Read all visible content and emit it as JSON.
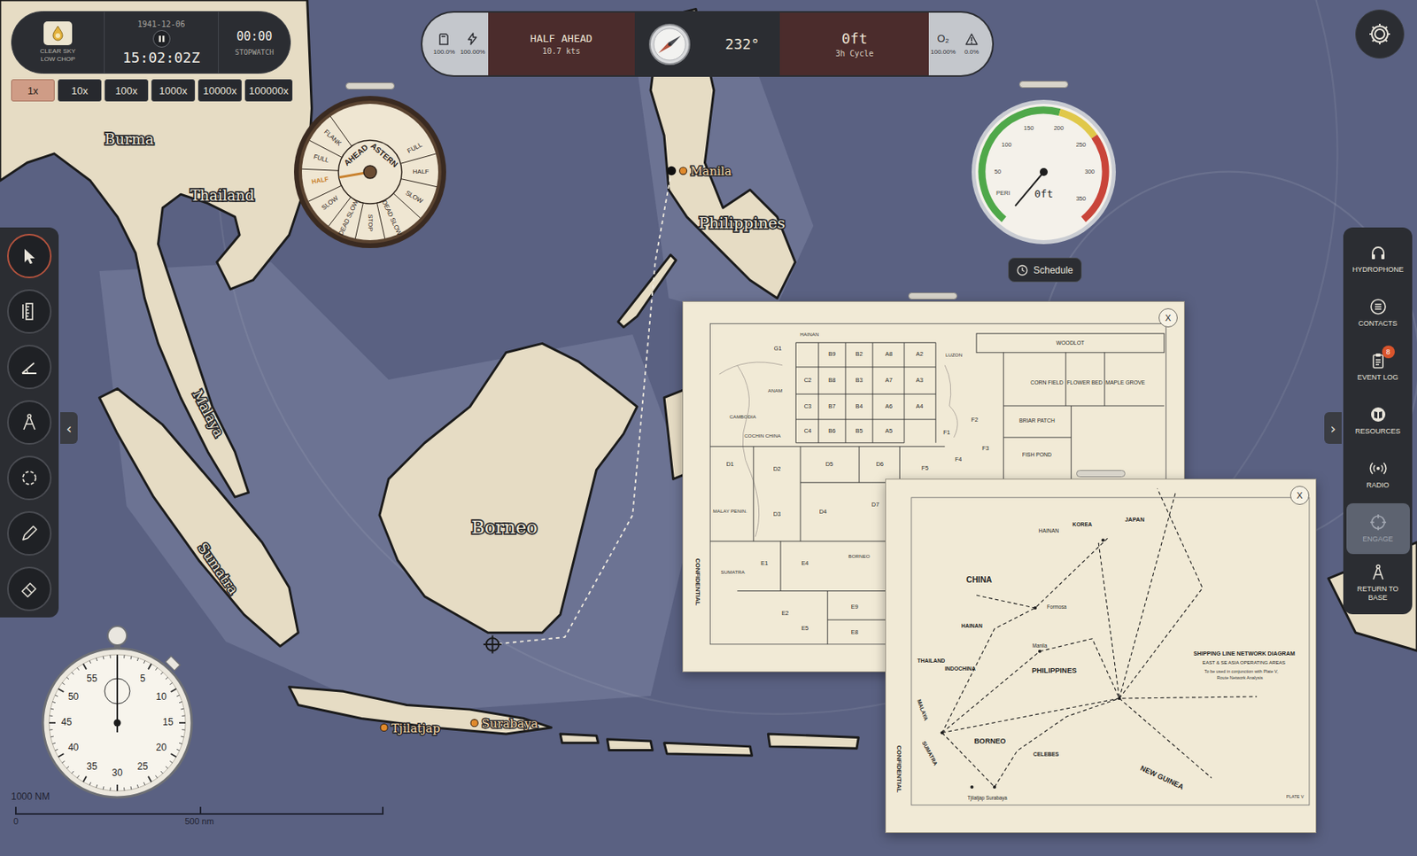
{
  "clock": {
    "weather": {
      "sky": "CLEAR SKY",
      "sea": "LOW CHOP"
    },
    "date": "1941-12-06",
    "time": "15:02:02Z",
    "running": true,
    "stopwatch": "00:00",
    "stopwatch_label": "STOPWATCH"
  },
  "time_compression": [
    {
      "label": "1x",
      "selected": true
    },
    {
      "label": "10x",
      "selected": false
    },
    {
      "label": "100x",
      "selected": false
    },
    {
      "label": "1000x",
      "selected": false
    },
    {
      "label": "10000x",
      "selected": false
    },
    {
      "label": "100000x",
      "selected": false
    }
  ],
  "status_bar": {
    "fuel": "100.0%",
    "battery": "100.00%",
    "order": "HALF AHEAD",
    "speed": "10.7 kts",
    "heading": "232°",
    "heading_deg": 232,
    "depth": "0ft",
    "cycle": "3h Cycle",
    "oxygen_label": "O₂",
    "oxygen": "100.00%",
    "alert": "0.0%"
  },
  "telegraph": {
    "ahead": "AHEAD",
    "astern": "ASTERN",
    "orders": [
      {
        "text": "FLANK",
        "selected": false
      },
      {
        "text": "FULL",
        "selected": false
      },
      {
        "text": "HALF",
        "selected": true
      },
      {
        "text": "SLOW",
        "selected": false
      },
      {
        "text": "DEAD SLOW",
        "selected": false
      },
      {
        "text": "STOP",
        "selected": false
      },
      {
        "text": "DEAD SLOW",
        "selected": false
      },
      {
        "text": "SLOW",
        "selected": false
      },
      {
        "text": "HALF",
        "selected": false
      },
      {
        "text": "FULL",
        "selected": false
      }
    ]
  },
  "depth_gauge": {
    "ticks": [
      "PERI",
      "50",
      "100",
      "150",
      "200",
      "250",
      "300",
      "350"
    ],
    "reading": "0ft",
    "level": 0
  },
  "schedule_button": {
    "label": "Schedule"
  },
  "tools": [
    {
      "selected": true
    },
    {
      "selected": false
    },
    {
      "selected": false
    },
    {
      "selected": false
    },
    {
      "selected": false
    },
    {
      "selected": false
    },
    {
      "selected": false
    }
  ],
  "left_panel_toggle": "‹",
  "right_panel_toggle": "›",
  "side_panel": [
    {
      "label": "HYDROPHONE",
      "disabled": false,
      "badge": ""
    },
    {
      "label": "CONTACTS",
      "disabled": false,
      "badge": ""
    },
    {
      "label": "EVENT LOG",
      "disabled": false,
      "badge": "8"
    },
    {
      "label": "RESOURCES",
      "disabled": false,
      "badge": ""
    },
    {
      "label": "RADIO",
      "disabled": false,
      "badge": ""
    },
    {
      "label": "ENGAGE",
      "disabled": true,
      "badge": ""
    },
    {
      "label": "RETURN TO BASE",
      "disabled": false,
      "badge": ""
    }
  ],
  "map": {
    "regions": [
      "Burma",
      "Thailand",
      "Malaya",
      "Sumatra",
      "Borneo",
      "Philippines"
    ],
    "ports": [
      "Manila",
      "Tjilatjap",
      "Surabaya"
    ],
    "scale": {
      "title": "1000 NM",
      "start": "0",
      "mid": "500 nm"
    }
  },
  "stopwatch_dial": {
    "numbers": [
      "55",
      "5",
      "10",
      "15",
      "20",
      "25",
      "30",
      "35",
      "40",
      "45",
      "50"
    ],
    "level": 0
  },
  "documents": [
    {
      "close": "X",
      "stamp": "CONFIDENTIAL",
      "labels": [
        "G1",
        "B9",
        "B2",
        "A8",
        "A2",
        "C2",
        "B8",
        "B3",
        "A7",
        "A3",
        "C3",
        "B7",
        "B4",
        "A6",
        "A4",
        "C4",
        "B6",
        "B5",
        "A5",
        "D1",
        "D2",
        "D5",
        "D6",
        "D7",
        "D3",
        "D4",
        "E1",
        "E4",
        "E2",
        "E5",
        "E9",
        "E8",
        "F1",
        "F2",
        "F3",
        "F4",
        "F5"
      ],
      "areas": [
        "WOODLOT",
        "CORN FIELD",
        "FLOWER BED",
        "MAPLE GROVE",
        "BRIAR PATCH",
        "FISH POND"
      ],
      "places": [
        "HAINAN",
        "ANAM",
        "CAMBODIA",
        "COCHIN CHINA",
        "MALAY PENIN.",
        "SUMATRA",
        "BORNEO",
        "LUZON"
      ]
    },
    {
      "close": "X",
      "stamp": "CONFIDENTIAL",
      "title": "SHIPPING LINE NETWORK DIAGRAM",
      "subtitle": "EAST & SE ASIA OPERATING AREAS",
      "note": [
        "To be used in conjunction with Plate V,",
        "Route Network Analysis"
      ],
      "plate": "PLATE V",
      "labels": [
        "HAINAN",
        "KOREA",
        "JAPAN",
        "CHINA",
        "Formosa",
        "HAINAN",
        "THAILAND",
        "INDOCHINA",
        "Manila",
        "PHILIPPINES",
        "MALAYA",
        "SUMATRA",
        "BORNEO",
        "CELEBES",
        "NEW GUINEA",
        "Tjilatjap Surabaya"
      ]
    }
  ]
}
